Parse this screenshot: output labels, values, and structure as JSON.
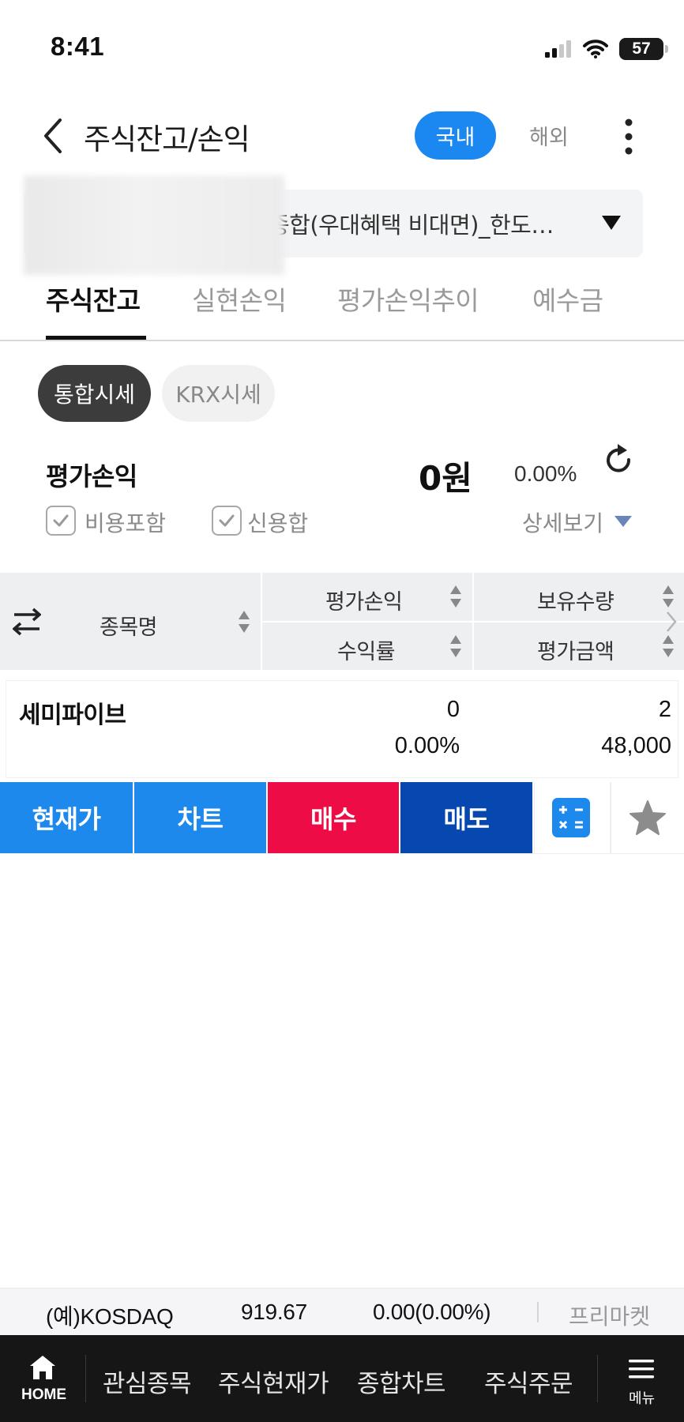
{
  "status_bar": {
    "time": "8:41",
    "battery": "57"
  },
  "header": {
    "title": "주식잔고/손익",
    "pill_domestic": "국내",
    "pill_overseas": "해외"
  },
  "account": {
    "text": "종합(우대혜택 비대면)_한도…"
  },
  "tabs": [
    {
      "label": "주식잔고",
      "active": true
    },
    {
      "label": "실현손익",
      "active": false
    },
    {
      "label": "평가손익추이",
      "active": false
    },
    {
      "label": "예수금",
      "active": false
    }
  ],
  "segment": {
    "integrated": "통합시세",
    "krx": "KRX시세"
  },
  "summary": {
    "label": "평가손익",
    "amount": "0원",
    "rate": "0.00%",
    "check_fee": "비용포함",
    "check_credit": "신용합",
    "detail": "상세보기"
  },
  "table": {
    "col_name": "종목명",
    "col_pnl": "평가손익",
    "col_rate": "수익률",
    "col_qty": "보유수량",
    "col_value": "평가금액",
    "rows": [
      {
        "name": "세미파이브",
        "pnl": "0",
        "rate": "0.00%",
        "qty": "2",
        "value": "48,000"
      }
    ]
  },
  "actions": {
    "price": "현재가",
    "chart": "차트",
    "buy": "매수",
    "sell": "매도"
  },
  "ticker": {
    "name": "(예)KOSDAQ",
    "value": "919.67",
    "change": "0.00(0.00%)",
    "session": "프리마켓"
  },
  "bottom_nav": {
    "home": "HOME",
    "items": [
      "관심종목",
      "주식현재가",
      "종합차트",
      "주식주문"
    ],
    "menu": "메뉴"
  },
  "colors": {
    "accent_blue": "#1d89ec",
    "buy_red": "#ee0c46",
    "sell_blue": "#0648b0",
    "nav_bg": "#161616"
  },
  "icons": [
    "back-icon",
    "more-icon",
    "dropdown-caret-icon",
    "refresh-icon",
    "check-icon",
    "swap-icon",
    "sort-icon",
    "calculator-icon",
    "star-icon",
    "home-icon",
    "menu-icon",
    "signal-icon",
    "wifi-icon",
    "battery-icon"
  ]
}
